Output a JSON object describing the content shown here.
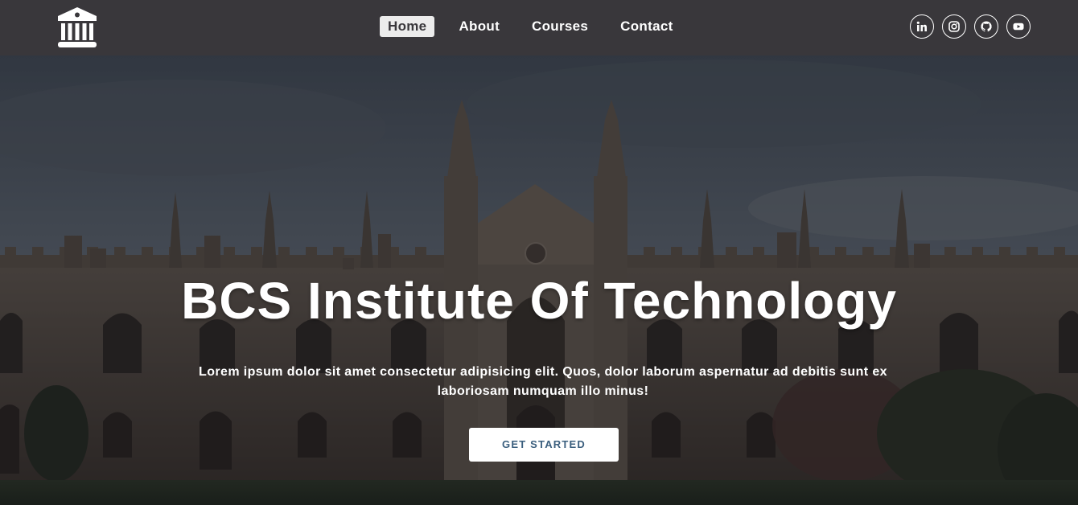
{
  "header": {
    "logo_icon": "institution-building-icon",
    "nav": [
      {
        "label": "Home",
        "active": true
      },
      {
        "label": "About",
        "active": false
      },
      {
        "label": "Courses",
        "active": false
      },
      {
        "label": "Contact",
        "active": false
      }
    ],
    "social": [
      {
        "icon": "linkedin-icon"
      },
      {
        "icon": "instagram-icon"
      },
      {
        "icon": "github-icon"
      },
      {
        "icon": "youtube-icon"
      }
    ]
  },
  "hero": {
    "title": "BCS Institute Of Technology",
    "text": "Lorem ipsum dolor sit amet consectetur adipisicing elit. Quos, dolor laborum aspernatur ad debitis sunt ex laboriosam numquam illo minus!",
    "cta_label": "GET STARTED",
    "background": "gothic-college-building-photo"
  },
  "colors": {
    "header_bg": "#39373b",
    "cta_text": "#3b5f7e",
    "active_nav_bg": "#ececec"
  }
}
